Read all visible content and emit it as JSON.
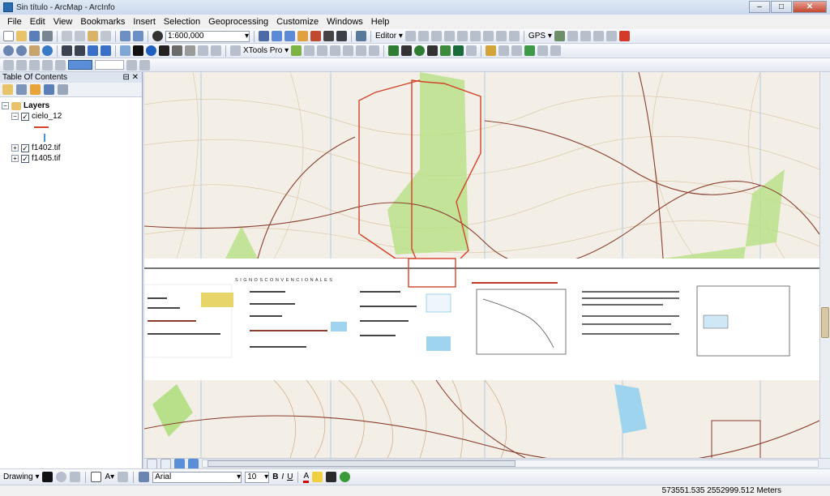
{
  "window": {
    "title": "Sin título - ArcMap - ArcInfo",
    "min": "–",
    "max": "□",
    "close": "✕"
  },
  "menu": [
    "File",
    "Edit",
    "View",
    "Bookmarks",
    "Insert",
    "Selection",
    "Geoprocessing",
    "Customize",
    "Windows",
    "Help"
  ],
  "toolbar": {
    "scale": "1:600,000",
    "editor_label": "Editor ▾",
    "gps_label": "GPS ▾",
    "xtools_label": "XTools Pro ▾"
  },
  "toc": {
    "title": "Table Of Contents",
    "pin": "⊟ ✕",
    "root": "Layers",
    "layers": [
      {
        "name": "cielo_12",
        "expanded": true,
        "checked": true
      },
      {
        "name": "f1402.tif",
        "expanded": false,
        "checked": true
      },
      {
        "name": "f1405.tif",
        "expanded": false,
        "checked": true
      }
    ]
  },
  "map": {
    "legend_title": "S I G N O S   C O N V E N C I O N A L E S",
    "boundary_color": "#d2432a",
    "vegetation_color": "#b8e08a",
    "water_color": "#9fd4ee"
  },
  "drawbar": {
    "drawing_label": "Drawing ▾",
    "font": "Arial",
    "size": "10"
  },
  "status": {
    "coords": "573551.535  2552999.512 Meters"
  }
}
